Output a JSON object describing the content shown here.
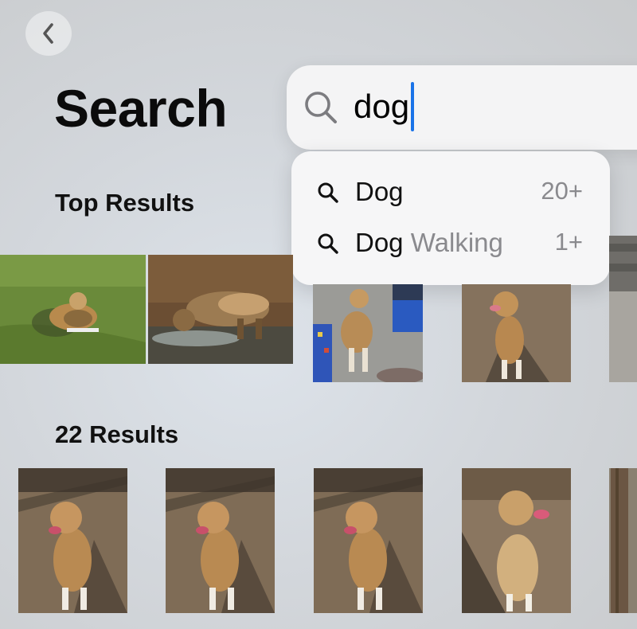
{
  "header": {
    "back_icon": "chevron-left-icon",
    "title": "Search"
  },
  "search": {
    "query": "dog",
    "icon": "magnifying-glass-icon",
    "caret_color": "#1a73e8"
  },
  "suggestions": [
    {
      "term": "Dog",
      "extra": "",
      "count": "20+"
    },
    {
      "term": "Dog",
      "extra": " Walking",
      "count": "1+"
    }
  ],
  "sections": {
    "top_results_title": "Top Results",
    "results_title": "22 Results"
  },
  "top_results": [
    {
      "scene": "dog lying on grass"
    },
    {
      "scene": "dog drinking in creek"
    },
    {
      "scene": "dog sitting indoors on leash"
    },
    {
      "scene": "dog sitting on dirt in sun"
    },
    {
      "scene": "partially visible photo"
    }
  ],
  "results": [
    {
      "scene": "dog sitting on dirt, tongue out"
    },
    {
      "scene": "dog sitting on dirt, tongue out"
    },
    {
      "scene": "dog sitting on dirt, tongue out"
    },
    {
      "scene": "dog sitting in shade, tongue out"
    },
    {
      "scene": "partially visible photo"
    }
  ]
}
